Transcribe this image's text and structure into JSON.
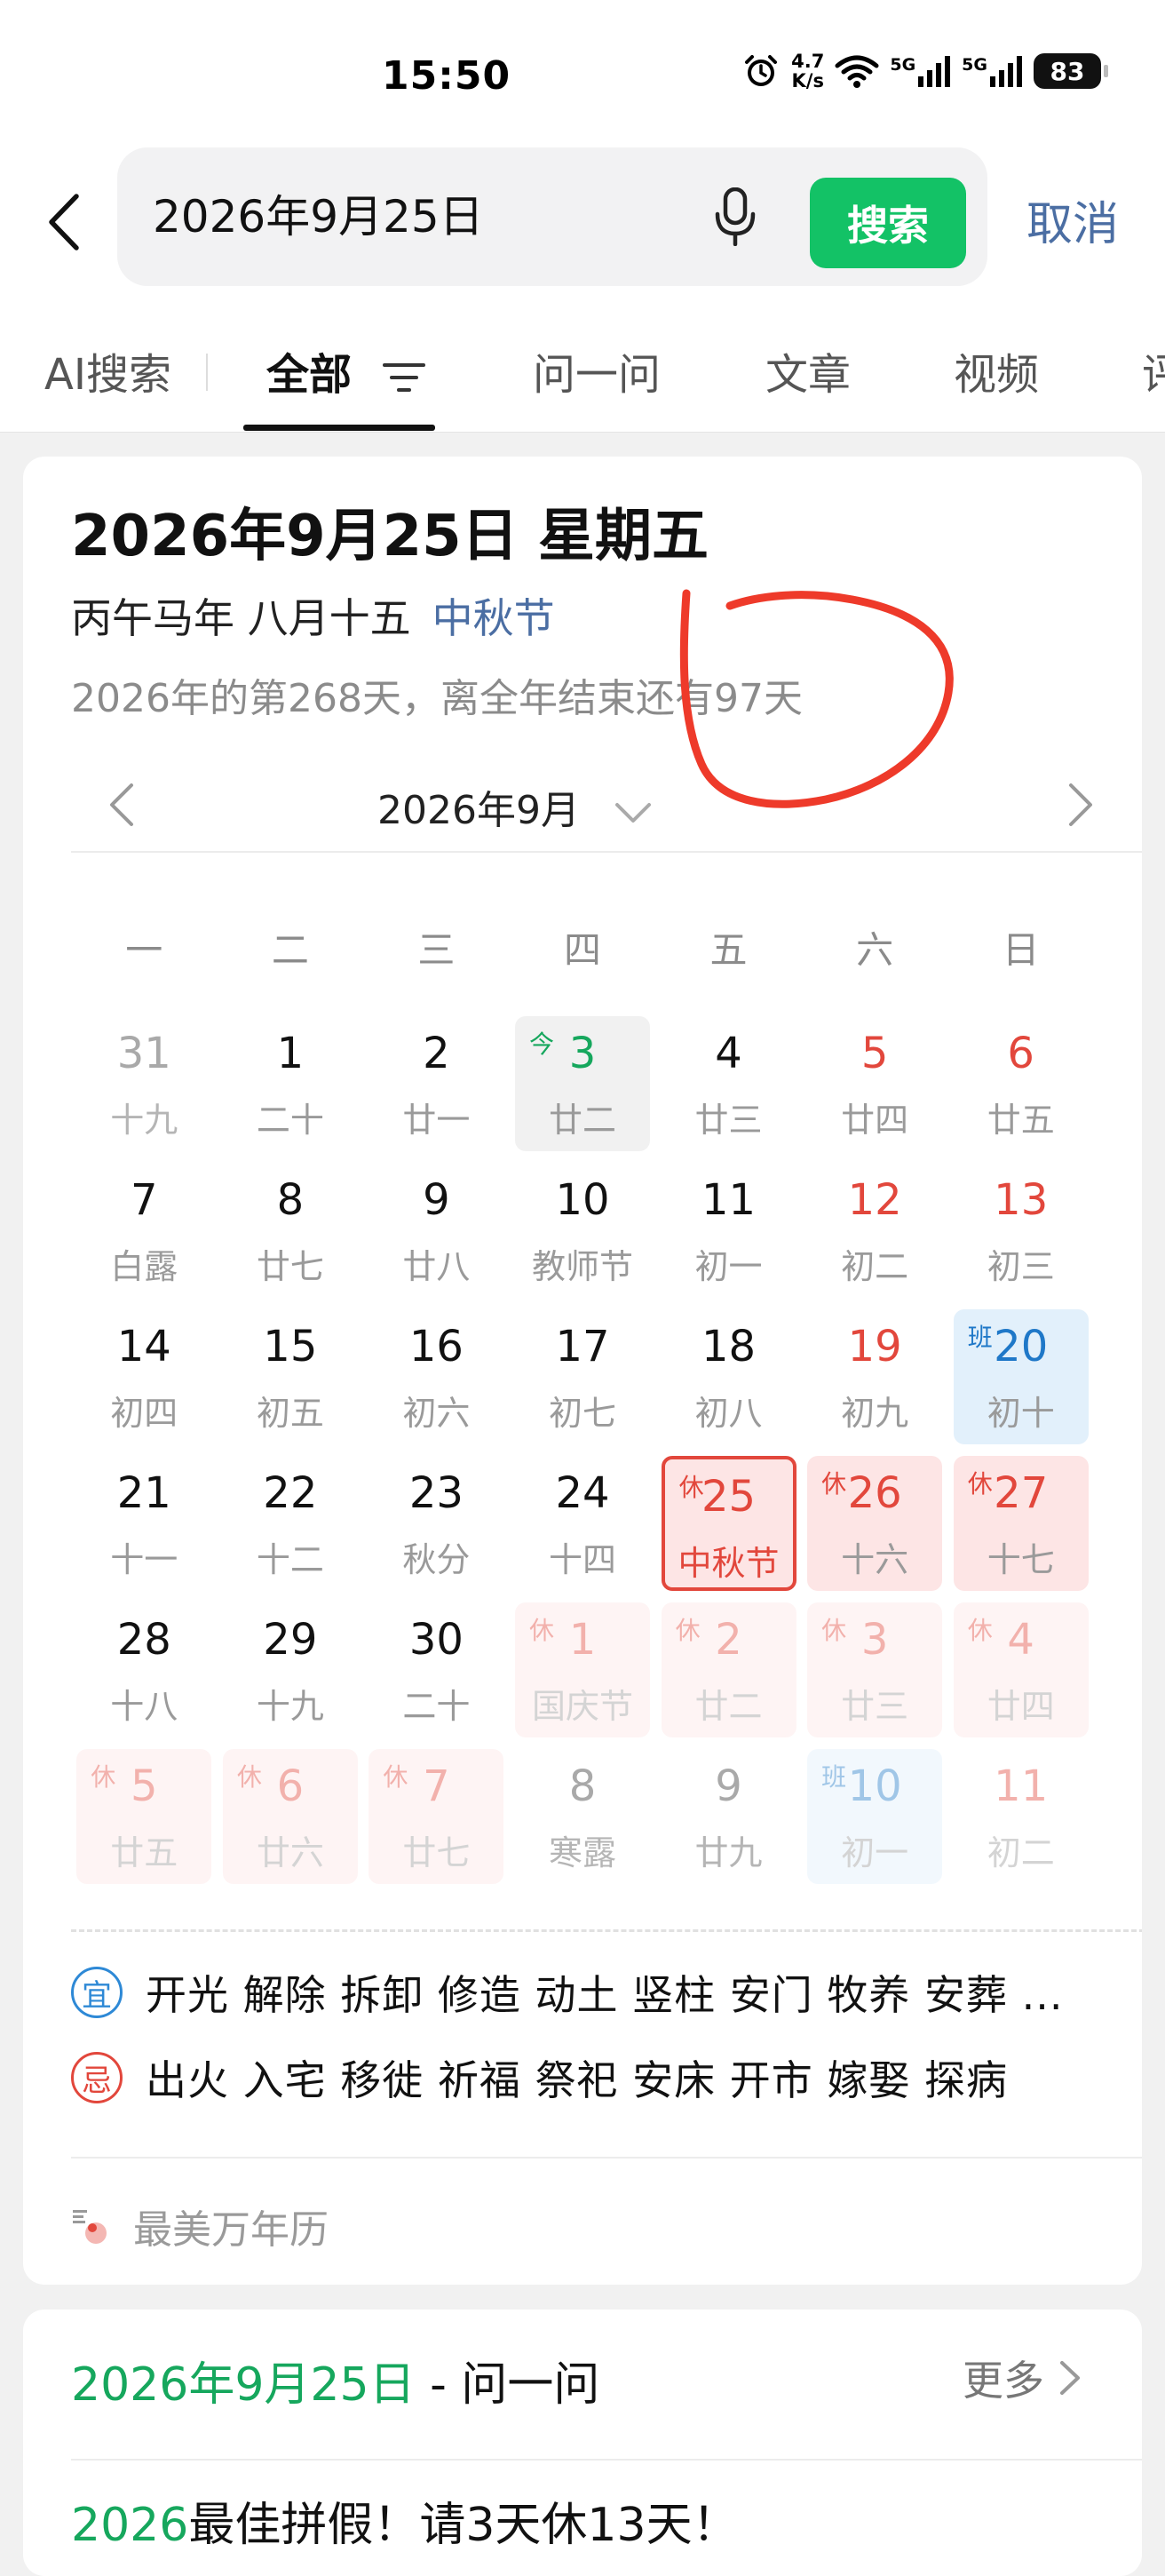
{
  "status_bar": {
    "time": "15:50",
    "net_speed_value": "4.7",
    "net_speed_unit": "K/s",
    "signal1": "5G",
    "signal2": "5G",
    "battery": "83",
    "icons": [
      "alarm-icon",
      "wifi-icon",
      "signal-icon",
      "signal-icon",
      "battery-icon"
    ]
  },
  "search": {
    "query": "2026年9月25日",
    "button_label": "搜索",
    "cancel_label": "取消"
  },
  "tabs": {
    "items": [
      "AI搜索",
      "全部",
      "问一问",
      "文章",
      "视频",
      "评"
    ],
    "active": "全部"
  },
  "calendar_card": {
    "title": "2026年9月25日 星期五",
    "lunar": "丙午马年 八月十五",
    "festival": "中秋节",
    "days_info": "2026年的第268天，离全年结束还有97天",
    "month_label": "2026年9月",
    "weekdays": [
      "一",
      "二",
      "三",
      "四",
      "五",
      "六",
      "日"
    ],
    "days": [
      {
        "num": "31",
        "sub": "十九",
        "type": "other"
      },
      {
        "num": "1",
        "sub": "二十",
        "type": "normal"
      },
      {
        "num": "2",
        "sub": "廿一",
        "type": "normal"
      },
      {
        "num": "3",
        "sub": "廿二",
        "type": "today",
        "mark": "今"
      },
      {
        "num": "4",
        "sub": "廿三",
        "type": "normal"
      },
      {
        "num": "5",
        "sub": "廿四",
        "type": "weekend"
      },
      {
        "num": "6",
        "sub": "廿五",
        "type": "weekend"
      },
      {
        "num": "7",
        "sub": "白露",
        "type": "normal"
      },
      {
        "num": "8",
        "sub": "廿七",
        "type": "normal"
      },
      {
        "num": "9",
        "sub": "廿八",
        "type": "normal"
      },
      {
        "num": "10",
        "sub": "教师节",
        "type": "normal"
      },
      {
        "num": "11",
        "sub": "初一",
        "type": "normal"
      },
      {
        "num": "12",
        "sub": "初二",
        "type": "weekend"
      },
      {
        "num": "13",
        "sub": "初三",
        "type": "weekend"
      },
      {
        "num": "14",
        "sub": "初四",
        "type": "normal"
      },
      {
        "num": "15",
        "sub": "初五",
        "type": "normal"
      },
      {
        "num": "16",
        "sub": "初六",
        "type": "normal"
      },
      {
        "num": "17",
        "sub": "初七",
        "type": "normal"
      },
      {
        "num": "18",
        "sub": "初八",
        "type": "normal"
      },
      {
        "num": "19",
        "sub": "初九",
        "type": "weekend"
      },
      {
        "num": "20",
        "sub": "初十",
        "type": "work",
        "mark": "班"
      },
      {
        "num": "21",
        "sub": "十一",
        "type": "normal"
      },
      {
        "num": "22",
        "sub": "十二",
        "type": "normal"
      },
      {
        "num": "23",
        "sub": "秋分",
        "type": "normal"
      },
      {
        "num": "24",
        "sub": "十四",
        "type": "normal"
      },
      {
        "num": "25",
        "sub": "中秋节",
        "type": "holiday-selected",
        "mark": "休"
      },
      {
        "num": "26",
        "sub": "十六",
        "type": "holiday",
        "mark": "休"
      },
      {
        "num": "27",
        "sub": "十七",
        "type": "holiday",
        "mark": "休"
      },
      {
        "num": "28",
        "sub": "十八",
        "type": "normal"
      },
      {
        "num": "29",
        "sub": "十九",
        "type": "normal"
      },
      {
        "num": "30",
        "sub": "二十",
        "type": "normal"
      },
      {
        "num": "1",
        "sub": "国庆节",
        "type": "holiday-other",
        "mark": "休"
      },
      {
        "num": "2",
        "sub": "廿二",
        "type": "holiday-other",
        "mark": "休"
      },
      {
        "num": "3",
        "sub": "廿三",
        "type": "holiday-other",
        "mark": "休"
      },
      {
        "num": "4",
        "sub": "廿四",
        "type": "holiday-other",
        "mark": "休"
      },
      {
        "num": "5",
        "sub": "廿五",
        "type": "holiday-other",
        "mark": "休"
      },
      {
        "num": "6",
        "sub": "廿六",
        "type": "holiday-other",
        "mark": "休"
      },
      {
        "num": "7",
        "sub": "廿七",
        "type": "holiday-other",
        "mark": "休"
      },
      {
        "num": "8",
        "sub": "寒露",
        "type": "other"
      },
      {
        "num": "9",
        "sub": "廿九",
        "type": "other"
      },
      {
        "num": "10",
        "sub": "初一",
        "type": "work-other",
        "mark": "班"
      },
      {
        "num": "11",
        "sub": "初二",
        "type": "weekend-other"
      }
    ],
    "yi_label": "宜",
    "yi_text": "开光 解除 拆卸 修造 动土 竖柱 安门 牧养 安葬 ...",
    "ji_label": "忌",
    "ji_text": "出火 入宅 移徙 祈福 祭祀 安床 开市 嫁娶 探病",
    "source": "最美万年历"
  },
  "ask_card": {
    "date": "2026年9月25日",
    "suffix": " - 问一问",
    "more": "更多",
    "item_highlight": "2026",
    "item_rest": "最佳拼假！请3天休13天！"
  },
  "colors": {
    "accent_green": "#13c266",
    "holiday_red": "#e2473c",
    "workday_blue": "#1f78c8",
    "link_blue": "#4b6ea3",
    "annotation_red": "#ee3a2a"
  }
}
